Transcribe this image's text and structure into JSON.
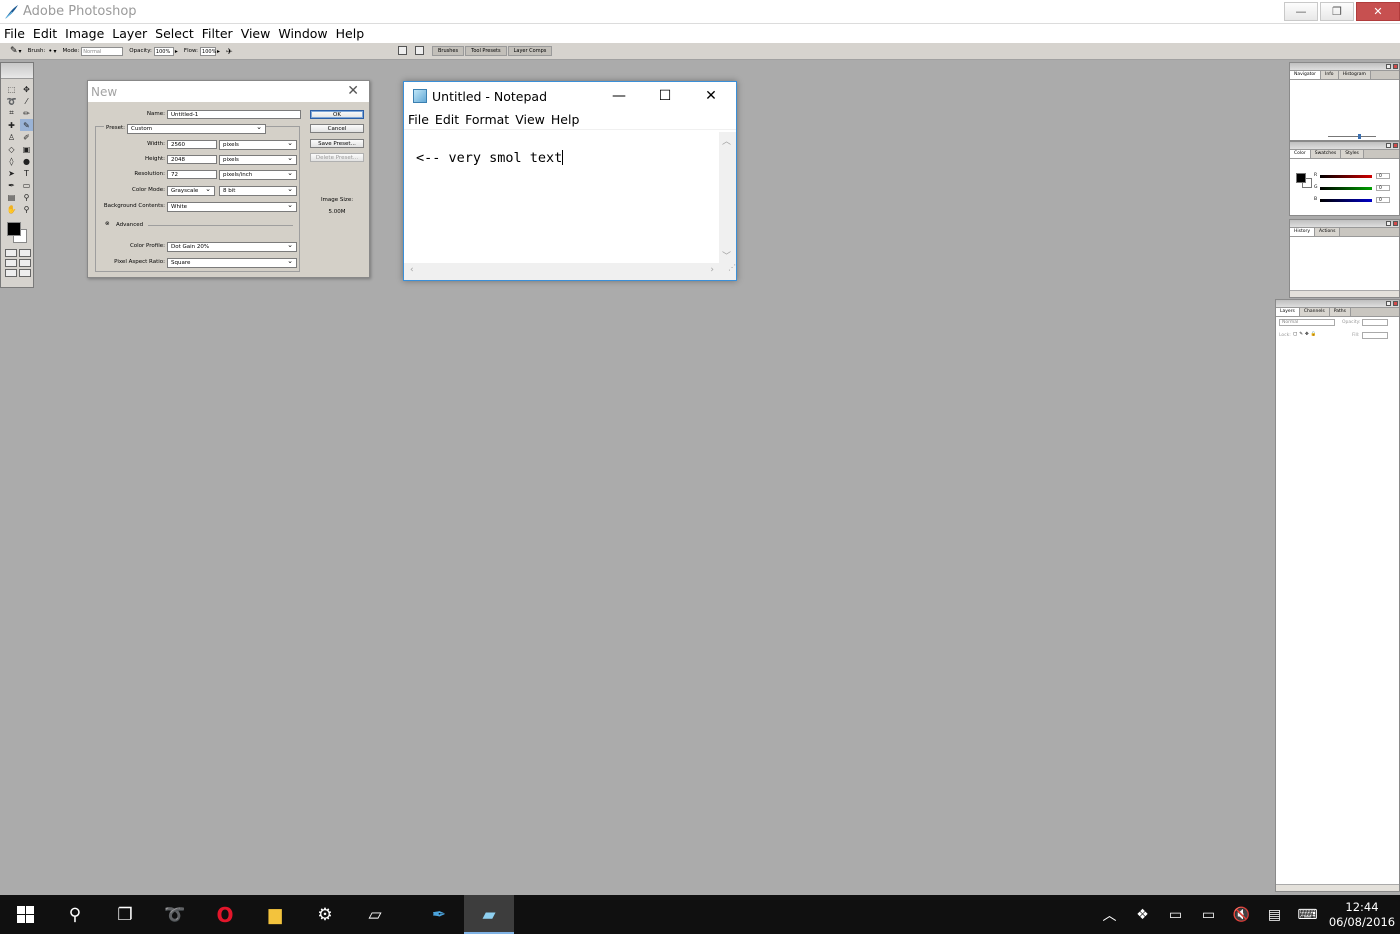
{
  "photoshop": {
    "title": "Adobe Photoshop",
    "menu": [
      "File",
      "Edit",
      "Image",
      "Layer",
      "Select",
      "Filter",
      "View",
      "Window",
      "Help"
    ],
    "options_bar": {
      "brush_label": "Brush:",
      "mode_label": "Mode:",
      "mode_value": "Normal",
      "opacity_label": "Opacity:",
      "opacity_value": "100%",
      "flow_label": "Flow:",
      "flow_value": "100%",
      "tabs": [
        "Brushes",
        "Tool Presets",
        "Layer Comps"
      ]
    }
  },
  "new_dialog": {
    "title": "New",
    "name_label": "Name:",
    "name_value": "Untitled-1",
    "preset_label": "Preset:",
    "preset_value": "Custom",
    "width_label": "Width:",
    "width_value": "2560",
    "width_unit": "pixels",
    "height_label": "Height:",
    "height_value": "2048",
    "height_unit": "pixels",
    "resolution_label": "Resolution:",
    "resolution_value": "72",
    "resolution_unit": "pixels/inch",
    "color_mode_label": "Color Mode:",
    "color_mode_value": "Grayscale",
    "bit_depth_value": "8 bit",
    "background_label": "Background Contents:",
    "background_value": "White",
    "advanced_label": "Advanced",
    "color_profile_label": "Color Profile:",
    "color_profile_value": "Dot Gain 20%",
    "pixel_aspect_label": "Pixel Aspect Ratio:",
    "pixel_aspect_value": "Square",
    "ok_label": "OK",
    "cancel_label": "Cancel",
    "save_preset_label": "Save Preset...",
    "delete_preset_label": "Delete Preset...",
    "image_size_label": "Image Size:",
    "image_size_value": "5.00M"
  },
  "notepad": {
    "title": "Untitled - Notepad",
    "menu": [
      "File",
      "Edit",
      "Format",
      "View",
      "Help"
    ],
    "content": "<-- very smol text"
  },
  "palettes": {
    "navigator_tabs": [
      "Navigator",
      "Info",
      "Histogram"
    ],
    "color_tabs": [
      "Color",
      "Swatches",
      "Styles"
    ],
    "color_channels": [
      {
        "label": "R",
        "value": "0",
        "color": "#d00000"
      },
      {
        "label": "G",
        "value": "0",
        "color": "#00a000"
      },
      {
        "label": "B",
        "value": "0",
        "color": "#0000c8"
      }
    ],
    "history_tabs": [
      "History",
      "Actions"
    ],
    "layers_tabs": [
      "Layers",
      "Channels",
      "Paths"
    ],
    "layers_mode": "Normal",
    "layers_opacity_label": "Opacity:",
    "layers_lock_label": "Lock:",
    "layers_fill_label": "Fill:"
  },
  "taskbar": {
    "apps": [
      "start-icon",
      "search-icon",
      "task-view-icon",
      "lasso-app-icon",
      "opera-icon",
      "file-explorer-icon",
      "settings-icon",
      "tablet-app-icon",
      "photoshop-icon",
      "notepad-icon"
    ],
    "time": "12:44",
    "date": "06/08/2016"
  },
  "colors": {
    "workspace": "#ababab",
    "notepad_border": "#3a8fd8",
    "taskbar": "#101010"
  }
}
